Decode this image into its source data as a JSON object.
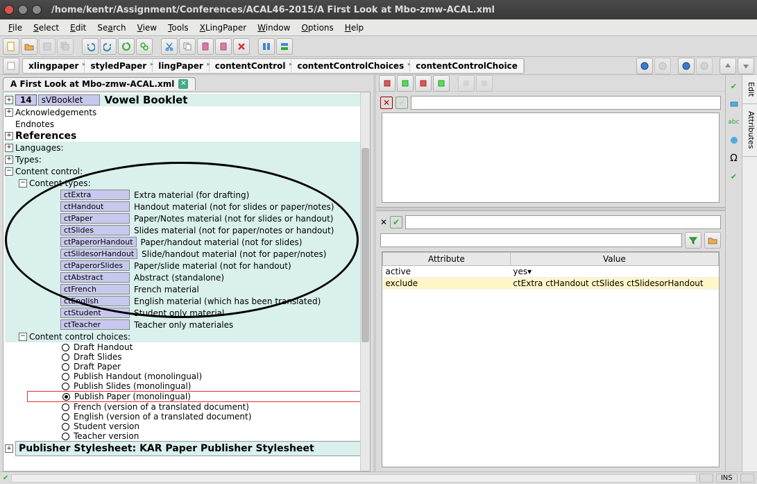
{
  "window": {
    "title": "/home/kentr/Assignment/Conferences/ACAL46-2015/A First Look at Mbo-zmw-ACAL.xml"
  },
  "menu": {
    "file": "File",
    "select": "Select",
    "edit": "Edit",
    "search": "Search",
    "view": "View",
    "tools": "Tools",
    "xling": "XLingPaper",
    "window": "Window",
    "options": "Options",
    "help": "Help"
  },
  "breadcrumb": [
    "xlingpaper",
    "styledPaper",
    "lingPaper",
    "contentControl",
    "contentControlChoices",
    "contentControlChoice"
  ],
  "tab": {
    "label": "A First Look at Mbo-zmw-ACAL.xml"
  },
  "tree": {
    "section_num": "14",
    "section_id": "sVBooklet",
    "section_title": "Vowel Booklet",
    "ack": "Acknowledgements",
    "endnotes": "Endnotes",
    "references": "References",
    "languages": "Languages:",
    "types": "Types:",
    "content_control": "Content control:",
    "content_types": "Content types:",
    "types_list": [
      {
        "id": "ctExtra",
        "desc": "Extra material (for drafting)"
      },
      {
        "id": "ctHandout",
        "desc": "Handout material (not for slides or paper/notes)"
      },
      {
        "id": "ctPaper",
        "desc": "Paper/Notes material (not for slides or handout)"
      },
      {
        "id": "ctSlides",
        "desc": "Slides material (not for paper/notes or handout)"
      },
      {
        "id": "ctPaperorHandout",
        "desc": "Paper/handout material (not for slides)"
      },
      {
        "id": "ctSlidesorHandout",
        "desc": "Slide/handout material (not for paper/notes)"
      },
      {
        "id": "ctPaperorSlides",
        "desc": "Paper/slide material (not for handout)"
      },
      {
        "id": "ctAbstract",
        "desc": "Abstract (standalone)"
      },
      {
        "id": "ctFrench",
        "desc": "French material"
      },
      {
        "id": "ctEnglish",
        "desc": "English material (which has been translated)"
      },
      {
        "id": "ctStudent",
        "desc": "Student only material"
      },
      {
        "id": "ctTeacher",
        "desc": "Teacher only materiales"
      }
    ],
    "choices_label": "Content control choices:",
    "choices": [
      "Draft Handout",
      "Draft Slides",
      "Draft Paper",
      "Publish Handout (monolingual)",
      "Publish Slides (monolingual)",
      "Publish Paper (monolingual)",
      "French (version of a translated document)",
      "English (version of a translated document)",
      "Student version",
      "Teacher version"
    ],
    "selected_choice_index": 5,
    "publisher": "Publisher Stylesheet: KAR Paper Publisher Stylesheet"
  },
  "attributes": {
    "header_attr": "Attribute",
    "header_val": "Value",
    "rows": [
      {
        "attr": "active",
        "val": "yes▾"
      },
      {
        "attr": "exclude",
        "val": "ctExtra ctHandout ctSlides ctSlidesorHandout"
      }
    ]
  },
  "side": {
    "edit": "Edit",
    "attrs": "Attributes"
  },
  "status": {
    "ins": "INS"
  }
}
